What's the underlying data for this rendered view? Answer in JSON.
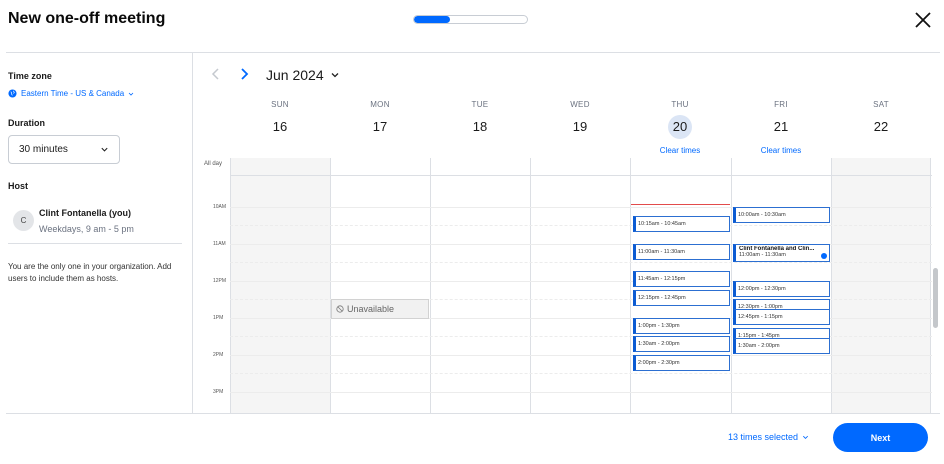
{
  "header": {
    "title": "New one-off meeting",
    "progress_percent": 32,
    "close_icon": "close-icon"
  },
  "sidebar": {
    "timezone_label": "Time zone",
    "timezone_value": "Eastern Time - US & Canada",
    "duration_label": "Duration",
    "duration_value": "30 minutes",
    "host_label": "Host",
    "host_initial": "C",
    "host_name": "Clint Fontanella (you)",
    "host_hours": "Weekdays, 9 am - 5 pm",
    "note": "You are the only one in your organization. Add users to include them as hosts."
  },
  "calendar": {
    "month": "Jun 2024",
    "allday_label": "All day",
    "days": [
      {
        "name": "SUN",
        "num": "16"
      },
      {
        "name": "MON",
        "num": "17"
      },
      {
        "name": "TUE",
        "num": "18"
      },
      {
        "name": "WED",
        "num": "19"
      },
      {
        "name": "THU",
        "num": "20"
      },
      {
        "name": "FRI",
        "num": "21"
      },
      {
        "name": "SAT",
        "num": "22"
      }
    ],
    "clear_times": "Clear times",
    "hours": [
      "10AM",
      "11AM",
      "12PM",
      "1PM",
      "2PM",
      "3PM"
    ],
    "unavailable": "Unavailable",
    "thu_slots": [
      "10:15am - 10:45am",
      "11:00am - 11:30am",
      "11:45am - 12:15pm",
      "12:15pm - 12:45pm",
      "1:00pm - 1:30pm",
      "1:30am - 2:00pm",
      "2:00pm - 2:30pm"
    ],
    "fri_slots": [
      "10:00am - 10:30am",
      "12:00pm - 12:30pm",
      "12:30pm - 1:00pm",
      "12:45pm - 1:15pm",
      "1:15pm - 1:45pm",
      "1:30am - 2:00pm"
    ],
    "event": {
      "title": "Clint Fontanella and Clin...",
      "time": "11:00am - 11:30am"
    }
  },
  "footer": {
    "selected": "13 times selected",
    "next": "Next"
  }
}
